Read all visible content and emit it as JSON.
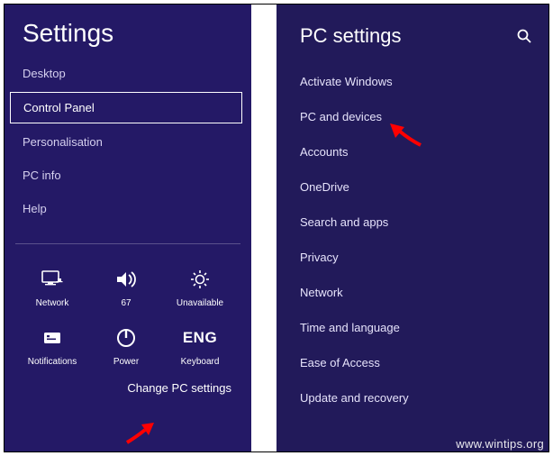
{
  "charms": {
    "title": "Settings",
    "items": [
      {
        "label": "Desktop",
        "selected": false
      },
      {
        "label": "Control Panel",
        "selected": true
      },
      {
        "label": "Personalisation",
        "selected": false
      },
      {
        "label": "PC info",
        "selected": false
      },
      {
        "label": "Help",
        "selected": false
      }
    ],
    "tiles": {
      "network": "Network",
      "volume_value": "67",
      "brightness": "Unavailable",
      "notifications": "Notifications",
      "power": "Power",
      "keyboard_lang": "ENG",
      "keyboard_label": "Keyboard"
    },
    "change_link": "Change PC settings"
  },
  "pc": {
    "title": "PC settings",
    "categories": [
      "Activate Windows",
      "PC and devices",
      "Accounts",
      "OneDrive",
      "Search and apps",
      "Privacy",
      "Network",
      "Time and language",
      "Ease of Access",
      "Update and recovery"
    ]
  },
  "watermark": "www.wintips.org"
}
